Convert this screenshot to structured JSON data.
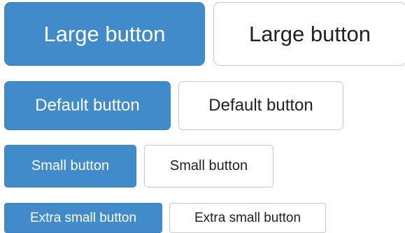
{
  "colors": {
    "primary_bg": "#428bca",
    "default_bg": "#ffffff",
    "default_border": "#c7c7c7",
    "primary_text": "#ffffff",
    "default_text": "#222222"
  },
  "rows": {
    "large": {
      "primary_label": "Large button",
      "default_label": "Large button"
    },
    "default": {
      "primary_label": "Default button",
      "default_label": "Default button"
    },
    "small": {
      "primary_label": "Small button",
      "default_label": "Small button"
    },
    "extra_small": {
      "primary_label": "Extra small button",
      "default_label": "Extra small button"
    }
  }
}
